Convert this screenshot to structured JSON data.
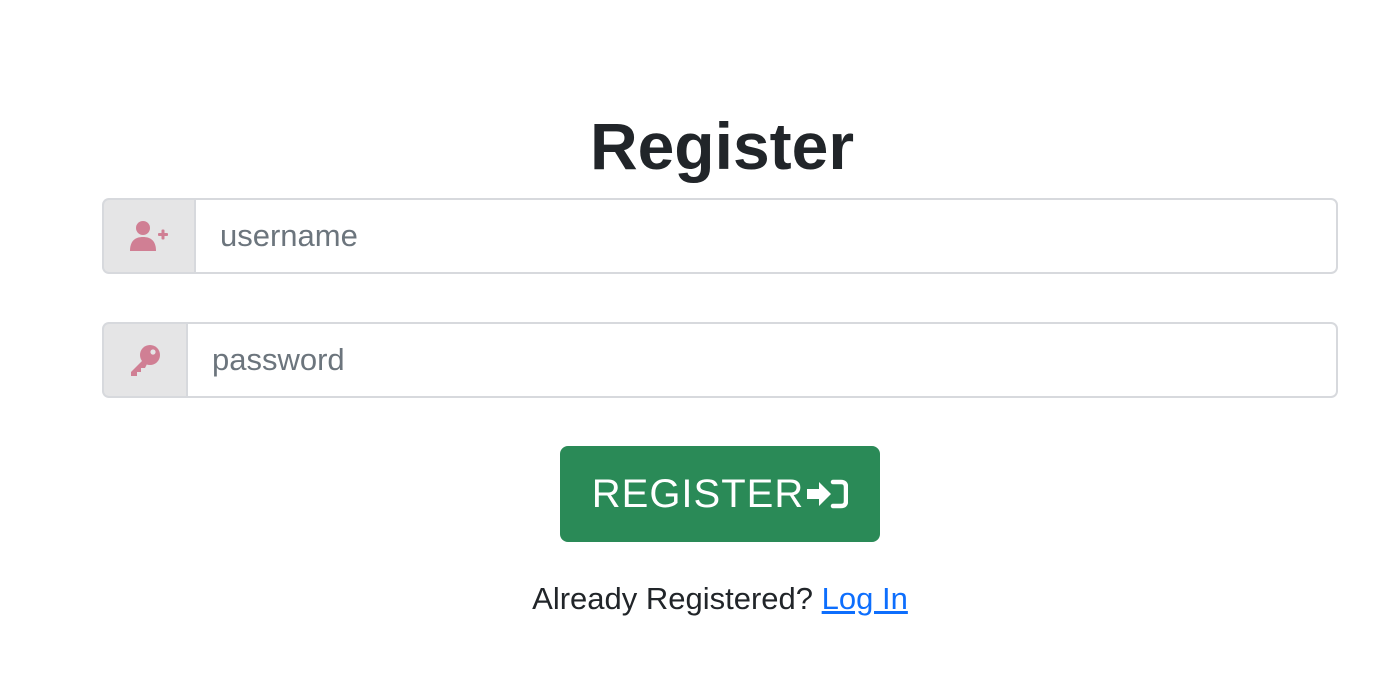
{
  "page": {
    "title": "Register"
  },
  "form": {
    "username": {
      "icon": "user-plus-icon",
      "placeholder": "username",
      "value": ""
    },
    "password": {
      "icon": "key-icon",
      "placeholder": "password",
      "value": ""
    },
    "submit": {
      "label": "REGISTER",
      "icon": "sign-in-icon"
    }
  },
  "footer": {
    "prompt": "Already Registered?",
    "link_label": "Log In"
  },
  "colors": {
    "icon_accent": "#d07f94",
    "button_bg": "#2a8a57",
    "link": "#0d6efd",
    "addon_bg": "#e5e5e6"
  }
}
